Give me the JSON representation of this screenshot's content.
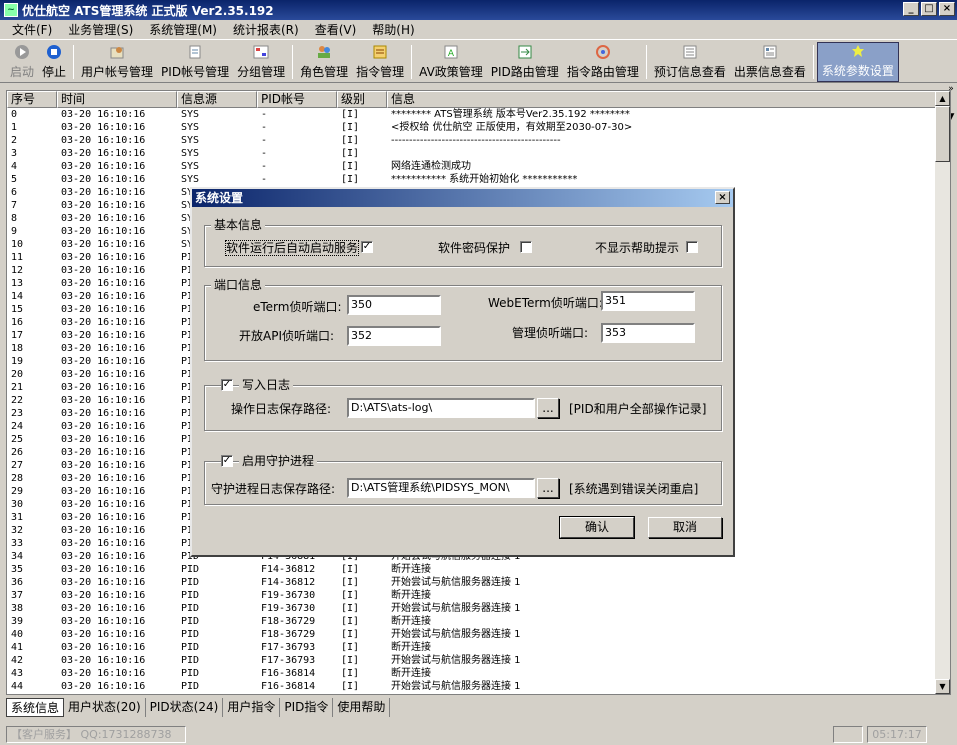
{
  "window": {
    "title": "优仕航空  ATS管理系统  正式版  Ver2.35.192",
    "min": "_",
    "max": "□",
    "close": "×"
  },
  "menu": [
    "文件(F)",
    "业务管理(S)",
    "系统管理(M)",
    "统计报表(R)",
    "查看(V)",
    "帮助(H)"
  ],
  "toolbar": [
    {
      "label": "启动",
      "icon": "start-icon",
      "disabled": true
    },
    {
      "label": "停止",
      "icon": "stop-icon"
    },
    {
      "label": "用户帐号管理",
      "icon": "user-account-icon"
    },
    {
      "label": "PID帐号管理",
      "icon": "pid-account-icon"
    },
    {
      "label": "分组管理",
      "icon": "group-icon"
    },
    {
      "label": "角色管理",
      "icon": "role-icon"
    },
    {
      "label": "指令管理",
      "icon": "command-icon"
    },
    {
      "label": "AV政策管理",
      "icon": "av-policy-icon"
    },
    {
      "label": "PID路由管理",
      "icon": "pid-route-icon"
    },
    {
      "label": "指令路由管理",
      "icon": "command-route-icon"
    },
    {
      "label": "预订信息查看",
      "icon": "booking-icon"
    },
    {
      "label": "出票信息查看",
      "icon": "ticket-icon"
    },
    {
      "label": "系统参数设置",
      "icon": "settings-icon",
      "active": true
    }
  ],
  "log": {
    "headers": [
      "序号",
      "时间",
      "信息源",
      "PID帐号",
      "级别",
      "信息"
    ],
    "rows": [
      [
        "0",
        "03-20 16:10:16",
        "SYS",
        "-",
        "[I]",
        "******** ATS管理系统 版本号Ver2.35.192 ********"
      ],
      [
        "1",
        "03-20 16:10:16",
        "SYS",
        "-",
        "[I]",
        "<授权给 优仕航空 正版使用，有效期至2030-07-30>"
      ],
      [
        "2",
        "03-20 16:10:16",
        "SYS",
        "-",
        "[I]",
        "-----------------------------------------------"
      ],
      [
        "3",
        "03-20 16:10:16",
        "SYS",
        "-",
        "[I]",
        ""
      ],
      [
        "4",
        "03-20 16:10:16",
        "SYS",
        "-",
        "[I]",
        "网络连通检测成功"
      ],
      [
        "5",
        "03-20 16:10:16",
        "SYS",
        "-",
        "[I]",
        "*********** 系统开始初始化 ***********"
      ],
      [
        "6",
        "03-20 16:10:16",
        "SY",
        "",
        "",
        " "
      ],
      [
        "7",
        "03-20 16:10:16",
        "SY",
        "",
        "",
        " "
      ],
      [
        "8",
        "03-20 16:10:16",
        "SY",
        "",
        "",
        " "
      ],
      [
        "9",
        "03-20 16:10:16",
        "SY",
        "",
        "",
        " "
      ],
      [
        "10",
        "03-20 16:10:16",
        "SY",
        "",
        "",
        " "
      ],
      [
        "11",
        "03-20 16:10:16",
        "PI",
        "",
        "",
        " "
      ],
      [
        "12",
        "03-20 16:10:16",
        "PI",
        "",
        "",
        " "
      ],
      [
        "13",
        "03-20 16:10:16",
        "PI",
        "",
        "",
        " "
      ],
      [
        "14",
        "03-20 16:10:16",
        "PI",
        "",
        "",
        " "
      ],
      [
        "15",
        "03-20 16:10:16",
        "PI",
        "",
        "",
        " "
      ],
      [
        "16",
        "03-20 16:10:16",
        "PI",
        "",
        "",
        " "
      ],
      [
        "17",
        "03-20 16:10:16",
        "PI",
        "",
        "",
        " "
      ],
      [
        "18",
        "03-20 16:10:16",
        "PI",
        "",
        "",
        " "
      ],
      [
        "19",
        "03-20 16:10:16",
        "PI",
        "",
        "",
        " "
      ],
      [
        "20",
        "03-20 16:10:16",
        "PI",
        "",
        "",
        " "
      ],
      [
        "21",
        "03-20 16:10:16",
        "PI",
        "",
        "",
        " "
      ],
      [
        "22",
        "03-20 16:10:16",
        "PI",
        "",
        "",
        " "
      ],
      [
        "23",
        "03-20 16:10:16",
        "PI",
        "",
        "",
        " "
      ],
      [
        "24",
        "03-20 16:10:16",
        "PI",
        "",
        "",
        " "
      ],
      [
        "25",
        "03-20 16:10:16",
        "PI",
        "",
        "",
        " "
      ],
      [
        "26",
        "03-20 16:10:16",
        "PI",
        "",
        "",
        " "
      ],
      [
        "27",
        "03-20 16:10:16",
        "PI",
        "",
        "",
        " "
      ],
      [
        "28",
        "03-20 16:10:16",
        "PI",
        "",
        "",
        " "
      ],
      [
        "29",
        "03-20 16:10:16",
        "PI",
        "",
        "",
        " "
      ],
      [
        "30",
        "03-20 16:10:16",
        "PI",
        "",
        "",
        " "
      ],
      [
        "31",
        "03-20 16:10:16",
        "PI",
        "",
        "",
        " "
      ],
      [
        "32",
        "03-20 16:10:16",
        "PI",
        "",
        "",
        " "
      ],
      [
        "33",
        "03-20 16:10:16",
        "PI",
        "",
        "",
        " "
      ],
      [
        "34",
        "03-20 16:10:16",
        "PID",
        "F14-36881",
        "[I]",
        "开始尝试与航信服务器连接 1"
      ],
      [
        "35",
        "03-20 16:10:16",
        "PID",
        "F14-36812",
        "[I]",
        "断开连接"
      ],
      [
        "36",
        "03-20 16:10:16",
        "PID",
        "F14-36812",
        "[I]",
        "开始尝试与航信服务器连接 1"
      ],
      [
        "37",
        "03-20 16:10:16",
        "PID",
        "F19-36730",
        "[I]",
        "断开连接"
      ],
      [
        "38",
        "03-20 16:10:16",
        "PID",
        "F19-36730",
        "[I]",
        "开始尝试与航信服务器连接 1"
      ],
      [
        "39",
        "03-20 16:10:16",
        "PID",
        "F18-36729",
        "[I]",
        "断开连接"
      ],
      [
        "40",
        "03-20 16:10:16",
        "PID",
        "F18-36729",
        "[I]",
        "开始尝试与航信服务器连接 1"
      ],
      [
        "41",
        "03-20 16:10:16",
        "PID",
        "F17-36793",
        "[I]",
        "断开连接"
      ],
      [
        "42",
        "03-20 16:10:16",
        "PID",
        "F17-36793",
        "[I]",
        "开始尝试与航信服务器连接 1"
      ],
      [
        "43",
        "03-20 16:10:16",
        "PID",
        "F16-36814",
        "[I]",
        "断开连接"
      ],
      [
        "44",
        "03-20 16:10:16",
        "PID",
        "F16-36814",
        "[I]",
        "开始尝试与航信服务器连接 1"
      ]
    ]
  },
  "tabs": [
    "系统信息",
    "用户状态(20)",
    "PID状态(24)",
    "用户指令",
    "PID指令",
    "使用帮助"
  ],
  "status": {
    "left": "【客户服务】 QQ:1731288738",
    "time": "05:17:17"
  },
  "dialog": {
    "title": "系统设置",
    "basic": {
      "legend": "基本信息",
      "autostart_label": "软件运行后自动启动服务",
      "autostart": true,
      "pwd_label": "软件密码保护",
      "pwd": false,
      "nohelp_label": "不显示帮助提示",
      "nohelp": false
    },
    "ports": {
      "legend": "端口信息",
      "eterm_label": "eTerm侦听端口:",
      "eterm": "350",
      "webeterm_label": "WebETerm侦听端口:",
      "webeterm": "351",
      "api_label": "开放API侦听端口:",
      "api": "352",
      "admin_label": "管理侦听端口:",
      "admin": "353"
    },
    "log": {
      "legend": "写入日志",
      "enabled": true,
      "path_label": "操作日志保存路径:",
      "path": "D:\\ATS\\ats-log\\",
      "browse": "...",
      "note": "[PID和用户全部操作记录]"
    },
    "guard": {
      "legend": "启用守护进程",
      "enabled": true,
      "path_label": "守护进程日志保存路径:",
      "path": "D:\\ATS管理系统\\PIDSYS_MON\\",
      "browse": "...",
      "note": "[系统遇到错误关闭重启]"
    },
    "ok": "确认",
    "cancel": "取消"
  }
}
